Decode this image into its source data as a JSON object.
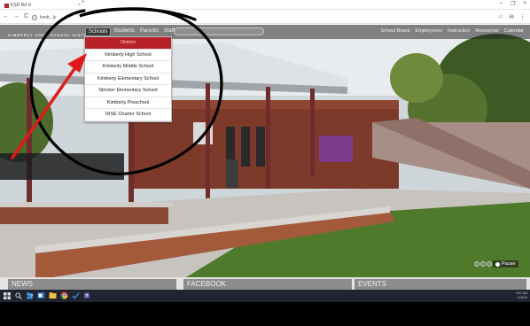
{
  "browser": {
    "tab_title": "KSD Rd U",
    "tab_close": "×",
    "new_tab": "+",
    "url": "kimb...ly",
    "window_controls": [
      "–",
      "❐",
      "×"
    ],
    "nav_back": "←",
    "nav_forward": "→",
    "nav_reload": "C",
    "right_icons": [
      "☆",
      "⊖",
      "⋮"
    ]
  },
  "site": {
    "district_name": "KIMBERLY AREA SCHOOL DISTRICT",
    "main_nav": [
      "Schools",
      "Students",
      "Parents",
      "Staff"
    ],
    "util_nav": [
      "School Board",
      "Employment",
      "Instruction",
      "Resources",
      "Calendar"
    ],
    "dropdown_items": [
      "District",
      "Kimberly High School",
      "Kimberly Middle School",
      "Kimberly Elementary School",
      "Stricker Elementary School",
      "Kimberly Preschool",
      "RISE Charter School"
    ],
    "pause_label": "Pause",
    "sections": [
      "NEWS",
      "FACEBOOK",
      "EVENTS"
    ]
  },
  "taskbar": {
    "tray_time": "9:07 AM",
    "tray_date": "11/3/20"
  },
  "colors": {
    "brand_red": "#b82127",
    "annotation_arrow": "#e0191b",
    "annotation_circle": "#000000"
  }
}
